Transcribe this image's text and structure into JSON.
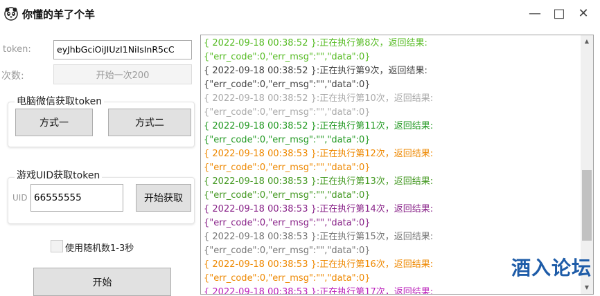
{
  "window": {
    "title": "你懂的羊了个羊",
    "minimize": "—",
    "maximize": "□",
    "close": "✕"
  },
  "form": {
    "token_label": "token:",
    "token_value": "eyJhbGciOiJIUzI1NiIsInR5cC",
    "count_label": "次数:",
    "run_once_label": "开始一次200"
  },
  "wechat_group": {
    "title": "电脑微信获取token",
    "method1_label": "方式一",
    "method2_label": "方式二"
  },
  "uid_group": {
    "title": "游戏UID获取token",
    "uid_label": "UID",
    "uid_value": "66555555",
    "fetch_label": "开始获取"
  },
  "options": {
    "random_delay_label": "使用随机数1-3秒",
    "start_label": "开始"
  },
  "colors": {
    "log": [
      "#55bb22",
      "#444444",
      "#aaaaaa",
      "#229922",
      "#ee8800",
      "#449922",
      "#882288",
      "#777777",
      "#ee8800",
      "#bb22bb"
    ]
  },
  "log": [
    {
      "head": "{ 2022-09-18 00:38:52 }:正在执行第8次，返回结果:",
      "body": "{\"err_code\":0,\"err_msg\":\"\",\"data\":0}"
    },
    {
      "head": "{ 2022-09-18 00:38:52 }:正在执行第9次，返回结果:",
      "body": "{\"err_code\":0,\"err_msg\":\"\",\"data\":0}"
    },
    {
      "head": "{ 2022-09-18 00:38:52 }:正在执行第10次，返回结果:",
      "body": "{\"err_code\":0,\"err_msg\":\"\",\"data\":0}"
    },
    {
      "head": "{ 2022-09-18 00:38:52 }:正在执行第11次，返回结果:",
      "body": "{\"err_code\":0,\"err_msg\":\"\",\"data\":0}"
    },
    {
      "head": "{ 2022-09-18 00:38:53 }:正在执行第12次，返回结果:",
      "body": "{\"err_code\":0,\"err_msg\":\"\",\"data\":0}"
    },
    {
      "head": "{ 2022-09-18 00:38:53 }:正在执行第13次，返回结果:",
      "body": "{\"err_code\":0,\"err_msg\":\"\",\"data\":0}"
    },
    {
      "head": "{ 2022-09-18 00:38:53 }:正在执行第14次，返回结果:",
      "body": "{\"err_code\":0,\"err_msg\":\"\",\"data\":0}"
    },
    {
      "head": "{ 2022-09-18 00:38:53 }:正在执行第15次，返回结果:",
      "body": "{\"err_code\":0,\"err_msg\":\"\",\"data\":0}"
    },
    {
      "head": "{ 2022-09-18 00:38:53 }:正在执行第16次，返回结果:",
      "body": "{\"err_code\":0,\"err_msg\":\"\",\"data\":0}"
    },
    {
      "head": "{ 2022-09-18 00:38:53 }:正在执行第17次，返回结果:",
      "body": ""
    }
  ],
  "watermark": "酒入论坛"
}
